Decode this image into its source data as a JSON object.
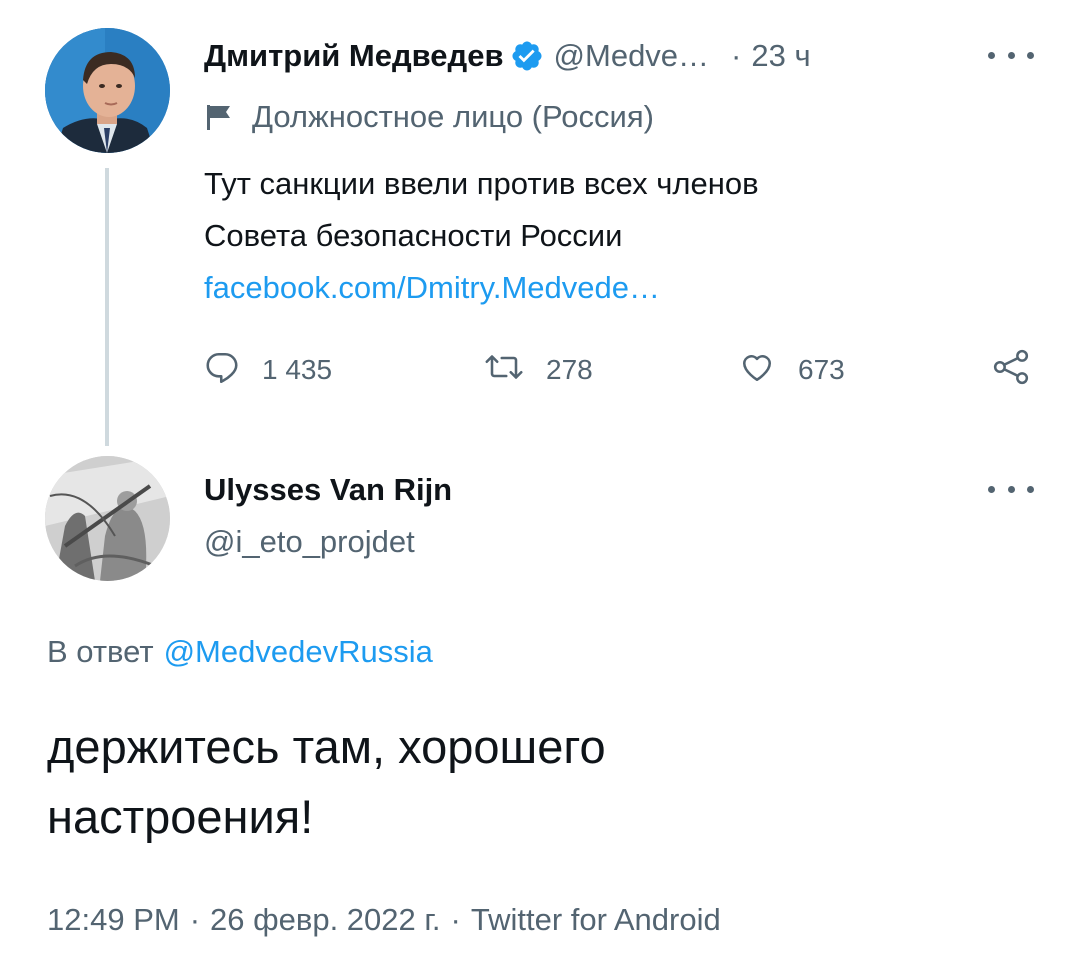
{
  "original_tweet": {
    "display_name": "Дмитрий Медведев",
    "handle": "@Medve…",
    "separator": "·",
    "time": "23 ч",
    "label": "Должностное лицо (Россия)",
    "text_lines": [
      "Тут санкции ввели против всех членов",
      "Совета безопасности России"
    ],
    "link": "facebook.com/Dmitry.Medvede…",
    "stats": {
      "replies": "1 435",
      "retweets": "278",
      "likes": "673"
    }
  },
  "reply_tweet": {
    "display_name": "Ulysses Van Rijn",
    "handle": "@i_eto_projdet",
    "reply_to_prefix": "В ответ",
    "reply_to_handle": "@MedvedevRussia",
    "text_lines": [
      "держитесь там, хорошего",
      "настроения!"
    ],
    "meta": {
      "time": "12:49 PM",
      "date": "26 февр. 2022 г.",
      "source": "Twitter for Android",
      "separator": "·"
    }
  },
  "colors": {
    "text": "#0f1419",
    "secondary": "#536471",
    "link": "#1d9bf0",
    "verified": "#1d9bf0",
    "thread_line": "#cfd9de"
  },
  "icons": {
    "verified": "verified-badge-icon",
    "label_flag": "flag-icon",
    "reply": "reply-icon",
    "retweet": "retweet-icon",
    "like": "heart-icon",
    "share": "share-icon",
    "more": "more-icon"
  }
}
